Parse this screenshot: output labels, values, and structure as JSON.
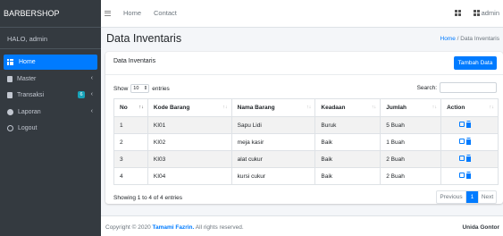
{
  "brand": "BARBERSHOP",
  "topnav": {
    "home": "Home",
    "contact": "Contact",
    "user": "admin"
  },
  "sidebar": {
    "greeting": "HALO, admin",
    "items": [
      {
        "label": "Home",
        "icon": "grid-icon"
      },
      {
        "label": "Master",
        "icon": "document-icon"
      },
      {
        "label": "Transaksi",
        "icon": "document-icon",
        "badge": "6"
      },
      {
        "label": "Laporan",
        "icon": "chart-icon"
      },
      {
        "label": "Logout",
        "icon": "power-icon"
      }
    ]
  },
  "page": {
    "title": "Data Inventaris",
    "breadcrumb_home": "Home",
    "breadcrumb_sep": "/",
    "breadcrumb_current": "Data Inventaris"
  },
  "card": {
    "title": "Data Inventaris",
    "add_button": "Tambah Data",
    "show_label": "Show",
    "entries_value": "10",
    "entries_label": "entries",
    "search_label": "Search:"
  },
  "table": {
    "headers": [
      "No",
      "Kode Barang",
      "Nama Barang",
      "Keadaan",
      "Jumlah",
      "Action"
    ],
    "rows": [
      [
        "1",
        "KI01",
        "Sapu Lidi",
        "Buruk",
        "5 Buah"
      ],
      [
        "2",
        "KI02",
        "meja kasir",
        "Baik",
        "1 Buah"
      ],
      [
        "3",
        "KI03",
        "alat cukur",
        "Baik",
        "2 Buah"
      ],
      [
        "4",
        "KI04",
        "kursi cukur",
        "Baik",
        "2 Buah"
      ]
    ]
  },
  "pagination": {
    "info": "Showing 1 to 4 of 4 entries",
    "previous": "Previous",
    "current": "1",
    "next": "Next"
  },
  "footer": {
    "copyright_prefix": "Copyright © 2020",
    "author": "Tamami Fazrin.",
    "rights": "All rights reserved.",
    "org": "Unida Gontor"
  },
  "colors": {
    "primary": "#007bff",
    "sidebar": "#343a40",
    "info": "#17a2b8"
  }
}
